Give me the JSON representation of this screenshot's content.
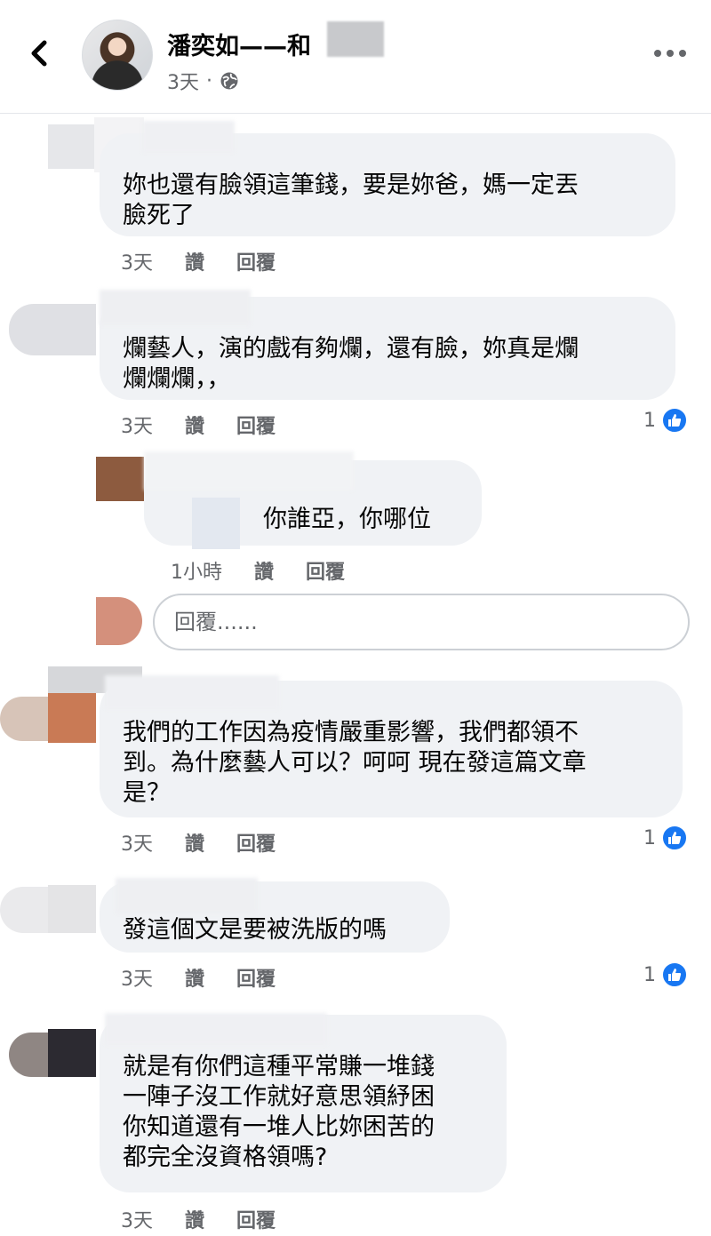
{
  "header": {
    "title": "潘奕如——和",
    "time": "3天",
    "separator": "·",
    "back_icon": "chevron-left-icon",
    "globe_icon": "globe-icon",
    "more_icon": "more-dots-icon"
  },
  "comments": [
    {
      "text": "妳也還有臉領這筆錢，要是妳爸，媽一定丟\n臉死了",
      "time": "3天",
      "like": "讚",
      "reply": "回覆",
      "likes": ""
    },
    {
      "text": "爛藝人，演的戲有夠爛，還有臉，妳真是爛\n爛爛爛，，",
      "time": "3天",
      "like": "讚",
      "reply": "回覆",
      "likes": "1"
    },
    {
      "text": "你誰亞，你哪位",
      "time": "1小時",
      "like": "讚",
      "reply": "回覆",
      "likes": ""
    },
    {
      "text": "我們的工作因為疫情嚴重影響，我們都領不\n到。為什麼藝人可以？呵呵 現在發這篇文章\n是？",
      "time": "3天",
      "like": "讚",
      "reply": "回覆",
      "likes": "1"
    },
    {
      "text": "發這個文是要被洗版的嗎",
      "time": "3天",
      "like": "讚",
      "reply": "回覆",
      "likes": "1"
    },
    {
      "text": "就是有你們這種平常賺一堆錢\n一陣子沒工作就好意思領紓困\n你知道還有一堆人比妳困苦的\n都完全沒資格領嗎?",
      "time": "3天",
      "like": "讚",
      "reply": "回覆",
      "likes": ""
    }
  ],
  "reply_box": {
    "placeholder": "回覆......"
  },
  "colors": {
    "bubble": "#f0f2f5",
    "like_blue": "#1877f2",
    "meta_gray": "#65676b"
  }
}
